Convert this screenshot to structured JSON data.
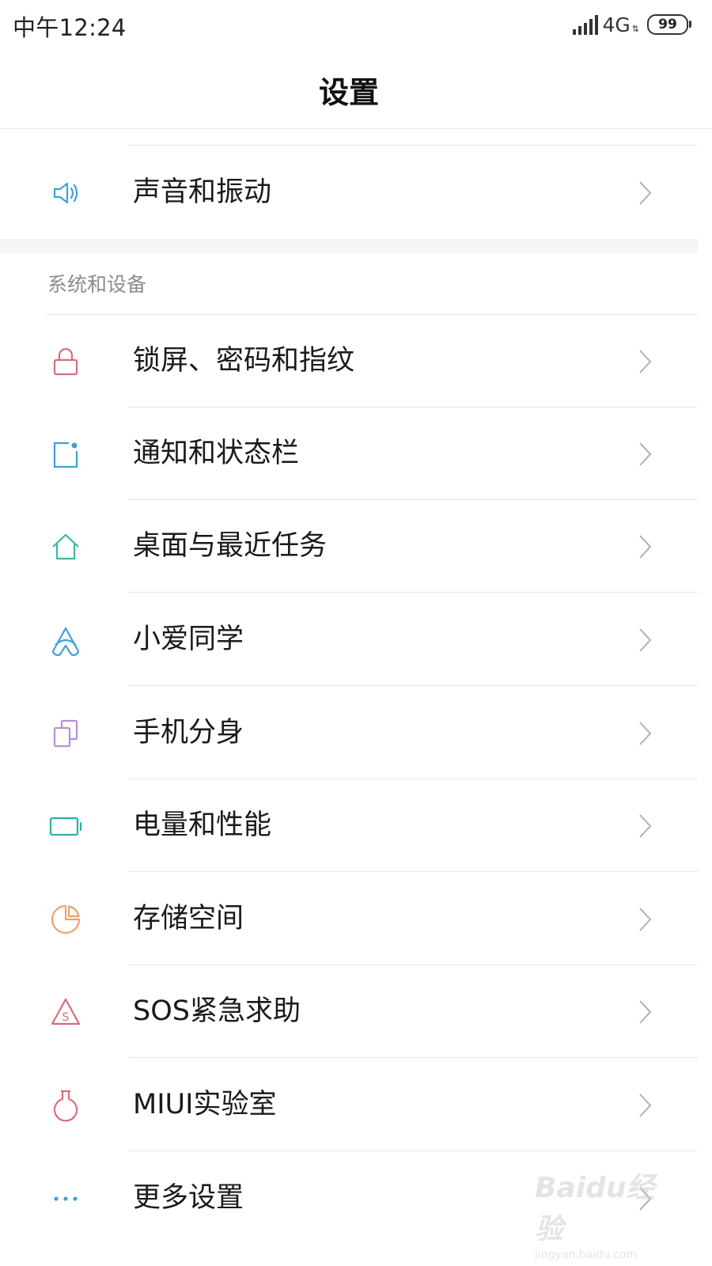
{
  "status": {
    "time": "中午12:24",
    "network": "4G",
    "battery": "99"
  },
  "header": {
    "title": "设置"
  },
  "top_items": [
    {
      "label": "声音和振动",
      "icon": "speaker-icon",
      "color": "#3fa1d8"
    }
  ],
  "section": {
    "title": "系统和设备",
    "items": [
      {
        "label": "锁屏、密码和指纹",
        "icon": "lock-icon",
        "color": "#d96d7b"
      },
      {
        "label": "通知和状态栏",
        "icon": "notification-icon",
        "color": "#3fa1d8"
      },
      {
        "label": "桌面与最近任务",
        "icon": "home-icon",
        "color": "#3cb6a6"
      },
      {
        "label": "小爱同学",
        "icon": "xiaoai-icon",
        "color": "#3fa1d8"
      },
      {
        "label": "手机分身",
        "icon": "second-space-icon",
        "color": "#b48fd6"
      },
      {
        "label": "电量和性能",
        "icon": "battery-icon",
        "color": "#2fb0a2"
      },
      {
        "label": "存储空间",
        "icon": "storage-pie-icon",
        "color": "#eda06a"
      },
      {
        "label": "SOS紧急求助",
        "icon": "sos-icon",
        "color": "#d96d7b"
      },
      {
        "label": "MIUI实验室",
        "icon": "lab-flask-icon",
        "color": "#d96d7b"
      },
      {
        "label": "更多设置",
        "icon": "more-dots-icon",
        "color": "#3fa1d8"
      }
    ]
  },
  "watermark": {
    "main": "Baidu经验",
    "sub": "jingyan.baidu.com"
  }
}
